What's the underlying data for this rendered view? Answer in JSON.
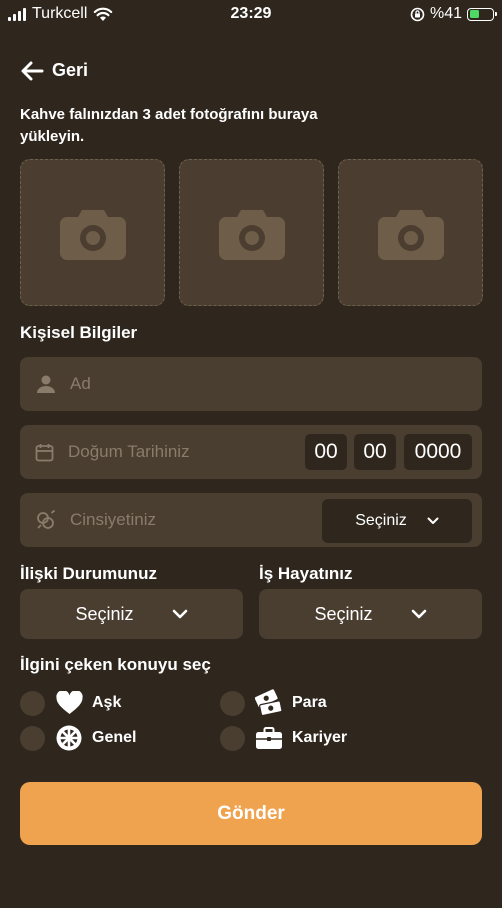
{
  "status_bar": {
    "carrier": "Turkcell",
    "time": "23:29",
    "battery": "%41"
  },
  "back_label": "Geri",
  "intro_text": "Kahve falınızdan 3 adet fotoğrafını buraya yükleyin.",
  "photos": [
    {
      "icon": "camera-icon"
    },
    {
      "icon": "camera-icon"
    },
    {
      "icon": "camera-icon"
    }
  ],
  "personal": {
    "title": "Kişisel Bilgiler",
    "name_placeholder": "Ad",
    "birth_placeholder": "Doğum Tarihiniz",
    "birth_day": "00",
    "birth_month": "00",
    "birth_year": "0000",
    "gender_placeholder": "Cinsiyetiniz",
    "gender_value": "Seçiniz"
  },
  "relationship": {
    "label": "İlişki Durumunuz",
    "value": "Seçiniz"
  },
  "work": {
    "label": "İş Hayatınız",
    "value": "Seçiniz"
  },
  "topics": {
    "title": "İlgini çeken konuyu seç",
    "items": [
      {
        "label": "Aşk",
        "icon": "heart-icon"
      },
      {
        "label": "Para",
        "icon": "money-icon"
      },
      {
        "label": "Genel",
        "icon": "wheel-icon"
      },
      {
        "label": "Kariyer",
        "icon": "briefcase-icon"
      }
    ]
  },
  "submit_label": "Gönder",
  "colors": {
    "background": "#2f271e",
    "field": "#4a3e31",
    "accent": "#f0a34f",
    "placeholder": "#8a7c6b"
  }
}
